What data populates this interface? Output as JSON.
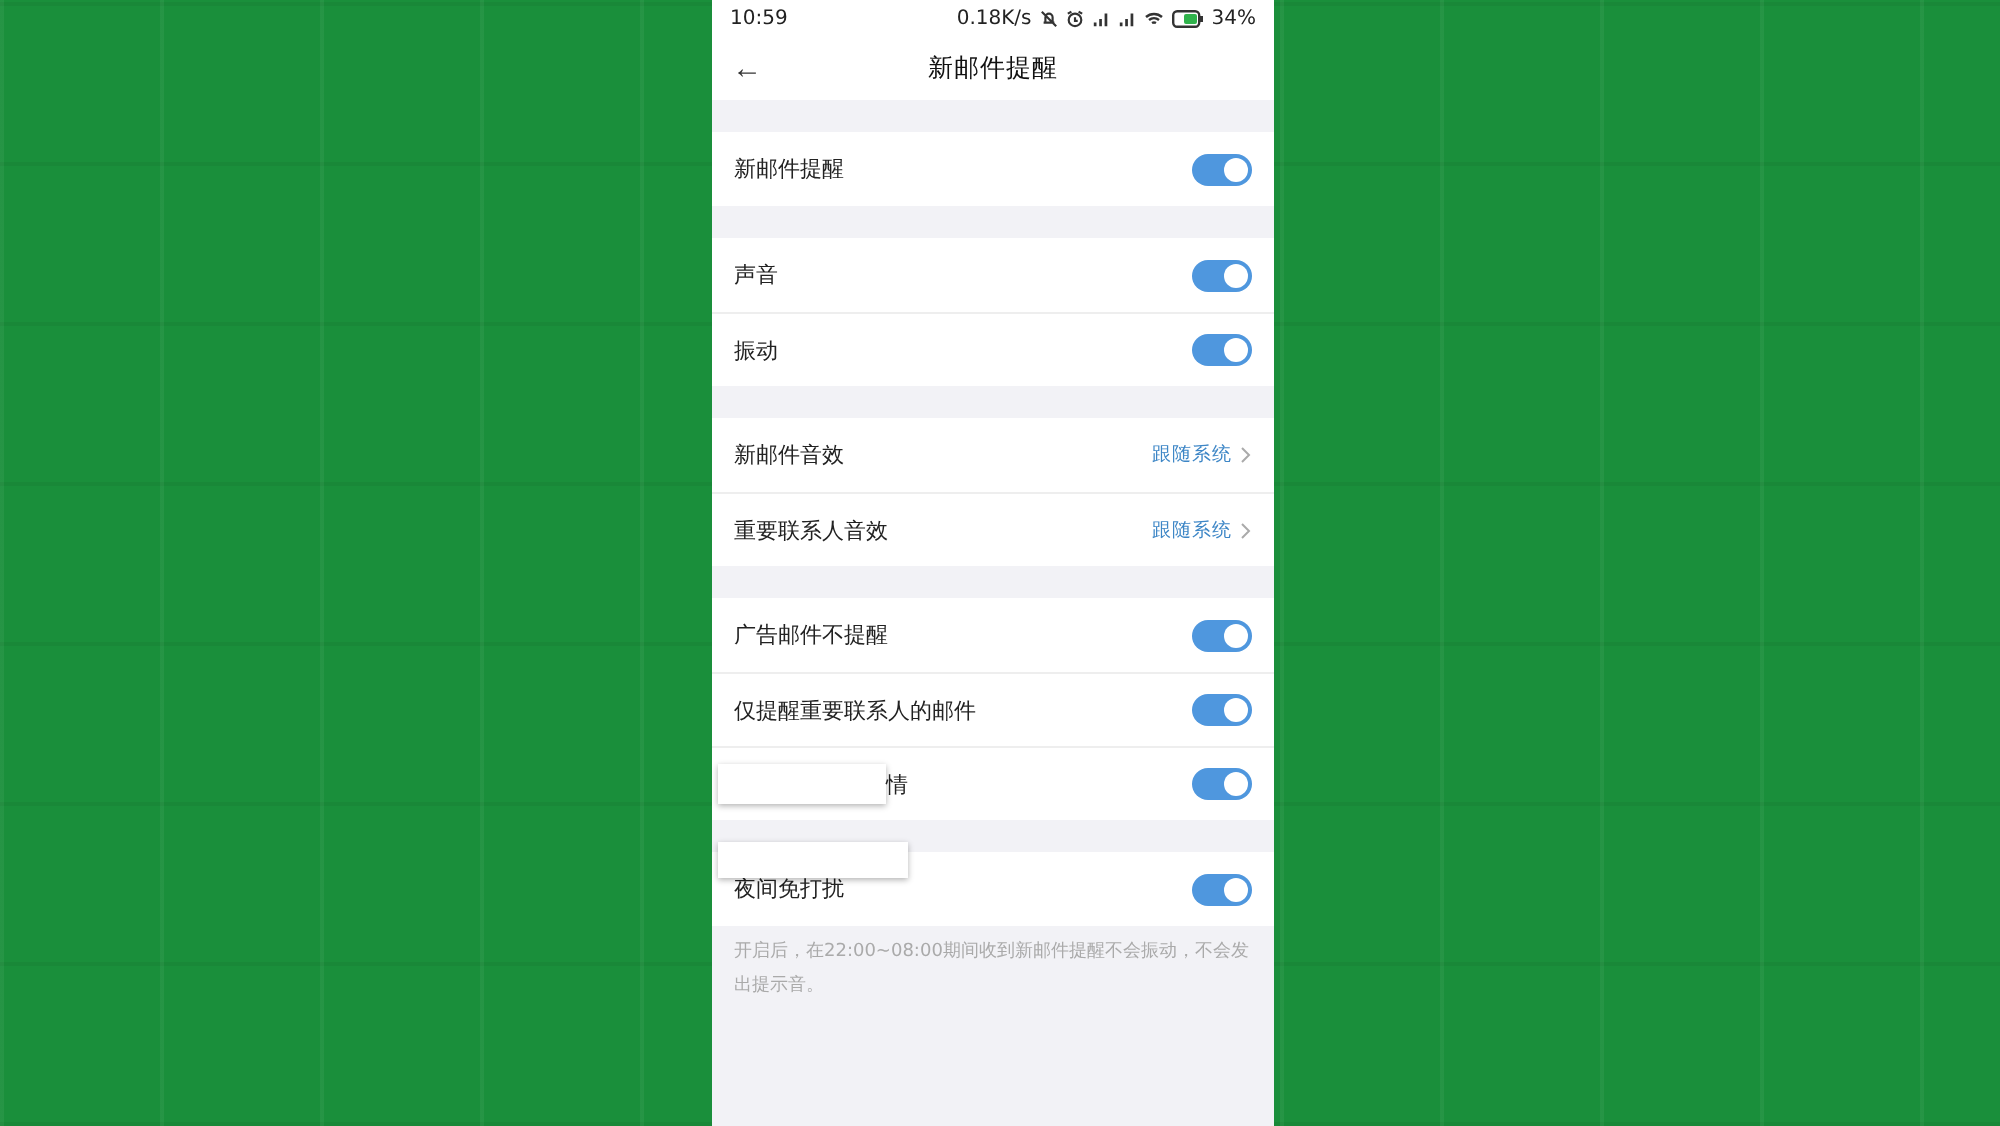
{
  "status_bar": {
    "time": "10:59",
    "speed": "0.18K/s",
    "battery": "34%"
  },
  "header": {
    "back": "←",
    "title": "新邮件提醒"
  },
  "groups": [
    {
      "rows": [
        {
          "kind": "toggle",
          "label": "新邮件提醒",
          "on": true
        }
      ]
    },
    {
      "rows": [
        {
          "kind": "toggle",
          "label": "声音",
          "on": true
        },
        {
          "kind": "toggle",
          "label": "振动",
          "on": true
        }
      ]
    },
    {
      "rows": [
        {
          "kind": "link",
          "label": "新邮件音效",
          "value": "跟随系统"
        },
        {
          "kind": "link",
          "label": "重要联系人音效",
          "value": "跟随系统"
        }
      ]
    },
    {
      "rows": [
        {
          "kind": "toggle",
          "label": "广告邮件不提醒",
          "on": true
        },
        {
          "kind": "toggle",
          "label": "仅提醒重要联系人的邮件",
          "on": true
        },
        {
          "kind": "toggle",
          "label": "情",
          "on": true,
          "covered": true
        }
      ]
    },
    {
      "patch": true,
      "rows": [
        {
          "kind": "toggle",
          "label": "夜间免打扰",
          "on": true
        }
      ]
    }
  ],
  "note": "开启后，在22:00~08:00期间收到新邮件提醒不会振动，不会发出提示音。"
}
